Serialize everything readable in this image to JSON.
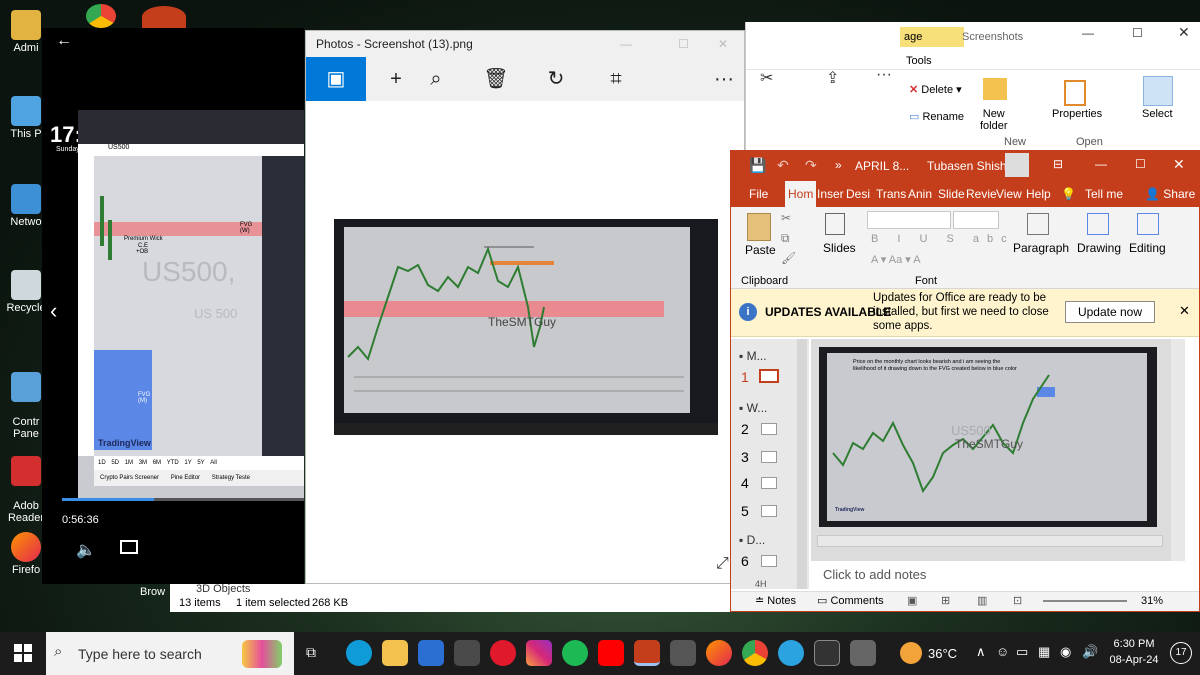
{
  "desktop": {
    "icons": [
      "Admi",
      "This P",
      "Netwo",
      "Recycle",
      "Contr\nPane",
      "Adob\nReader",
      "Firefo"
    ]
  },
  "video_player": {
    "timestamp": "0:56:36",
    "time_big": "17:",
    "day_label": "Sunday",
    "chart": {
      "symbol": "US500",
      "label_premium_wick": "Premium Wick",
      "label_ce": "C.E",
      "label_ob": "+OB",
      "label_fvg_upper": "FVG\n(W)",
      "label_fvg_lower": "FVG\n(M)",
      "watermark_big": "US500,",
      "watermark_small": "US 500",
      "brand": "TradingView",
      "timeframes": [
        "1D",
        "5D",
        "1M",
        "3M",
        "6M",
        "YTD",
        "1Y",
        "5Y",
        "All"
      ],
      "bottom_tabs": [
        "Crypto Pairs Screener",
        "Pine Editor",
        "Strategy Teste"
      ]
    }
  },
  "photos": {
    "title": "Photos - Screenshot (13).png",
    "watermark": "TheSMTGuy",
    "toolbar_more": "···"
  },
  "explorer": {
    "tab_manage": "age",
    "tab_tools": "Tools",
    "title": "Screenshots",
    "buttons": {
      "delete": "Delete",
      "rename": "Rename",
      "new_folder": "New\nfolder",
      "properties": "Properties",
      "select": "Select"
    },
    "groups": {
      "new": "New",
      "open": "Open"
    },
    "status": {
      "items": "13 items",
      "selected": "1 item selected",
      "size": "268 KB"
    },
    "nav_item": "3D Objects"
  },
  "ppt": {
    "title": "APRIL 8...",
    "user": "Tubasen Shishi",
    "tabs": [
      "File",
      "Hom",
      "Inser",
      "Desi",
      "Trans",
      "Anin",
      "Slide",
      "Revie",
      "View",
      "Help"
    ],
    "tell_me": "Tell me",
    "share": "Share",
    "ribbon": {
      "paste": "Paste",
      "clipboard": "Clipboard",
      "slides": "Slides",
      "font": "Font",
      "paragraph": "Paragraph",
      "drawing": "Drawing",
      "editing": "Editing"
    },
    "notice": {
      "title": "UPDATES AVAILABLE",
      "message": "Updates for Office are ready to be installed, but first we need to close some apps.",
      "button": "Update now"
    },
    "slide_panel": [
      {
        "n": "",
        "label": "M..."
      },
      {
        "n": "1",
        "label": ""
      },
      {
        "n": "",
        "label": "W..."
      },
      {
        "n": "2",
        "label": ""
      },
      {
        "n": "3",
        "label": ""
      },
      {
        "n": "4",
        "label": ""
      },
      {
        "n": "5",
        "label": ""
      },
      {
        "n": "",
        "label": "D..."
      },
      {
        "n": "6",
        "label": ""
      }
    ],
    "panel_cut": "4H",
    "slide_text": "Price on the monthly chart looks bearish and i am seeing the likelihood of it drawing down to the FVG created below in blue color",
    "slide_watermark_1": "US500",
    "slide_watermark_2": "TheSMTGuy",
    "slide_brand": "TradingView",
    "notes_placeholder": "Click to add notes",
    "status": {
      "notes": "Notes",
      "comments": "Comments",
      "zoom": "31%"
    }
  },
  "taskbar": {
    "search_placeholder": "Type here to search",
    "weather": "36°C",
    "time": "6:30 PM",
    "date": "08-Apr-24",
    "notif_count": "17"
  },
  "colors": {
    "ppt_red": "#c43e1c",
    "fvg_red": "#e88a8f",
    "fvg_blue": "#5b87e6",
    "candle_green": "#2e7d32",
    "taskbar": "#1c1c1c"
  }
}
